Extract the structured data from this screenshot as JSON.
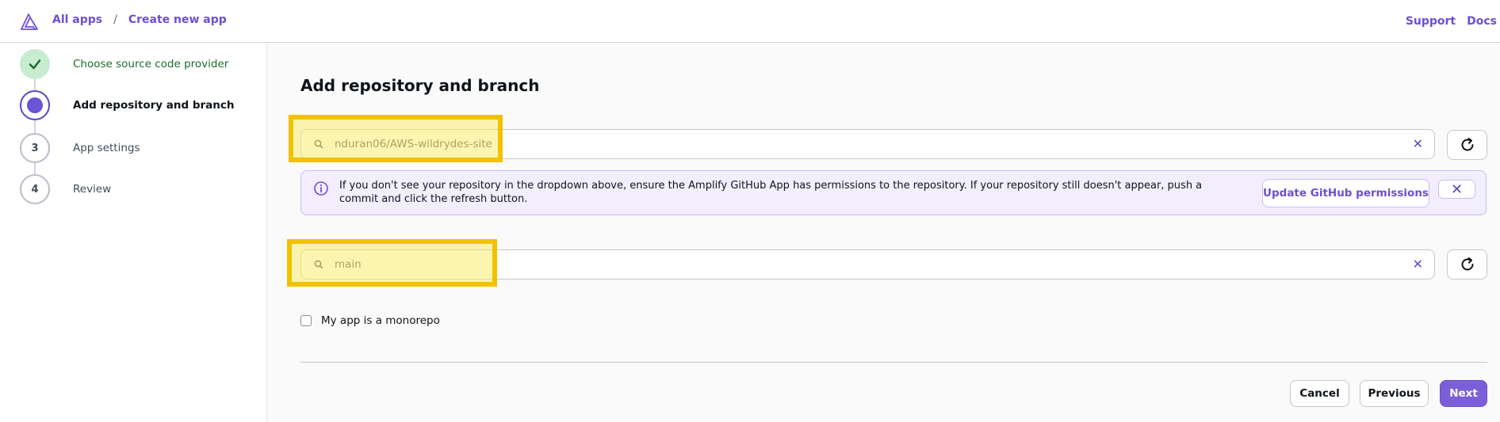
{
  "breadcrumb": {
    "root": "All apps",
    "separator": "/",
    "current": "Create new app"
  },
  "header": {
    "support": "Support",
    "docs": "Docs"
  },
  "steps": [
    {
      "number": "",
      "label": "Choose source code provider",
      "state": "done"
    },
    {
      "number": "",
      "label": "Add repository and branch",
      "state": "active"
    },
    {
      "number": "3",
      "label": "App settings",
      "state": "pending"
    },
    {
      "number": "4",
      "label": "Review",
      "state": "pending"
    }
  ],
  "main": {
    "title": "Add repository and branch",
    "repository": {
      "value": "nduran06/AWS-wildrydes-site",
      "clear_label": "✕"
    },
    "branch": {
      "value": "main",
      "clear_label": "✕"
    },
    "info": {
      "message": "If you don't see your repository in the dropdown above, ensure the Amplify GitHub App has permissions to the repository. If your repository still doesn't appear, push a commit and click the refresh button.",
      "update_button": "Update GitHub permissions",
      "dismiss_label": "✕"
    },
    "monorepo_label": "My app is a monorepo",
    "monorepo_checked": false
  },
  "footer": {
    "cancel": "Cancel",
    "previous": "Previous",
    "next": "Next"
  },
  "colors": {
    "accent": "#6c4fd3",
    "success_bg": "#c7ecd0",
    "highlight": "#f2c200",
    "info_bg": "#f2eefd"
  },
  "icons": {
    "logo": "amplify-logo-icon",
    "search": "search-icon",
    "refresh": "refresh-icon",
    "info": "info-icon",
    "check": "check-icon",
    "close": "close-icon"
  }
}
